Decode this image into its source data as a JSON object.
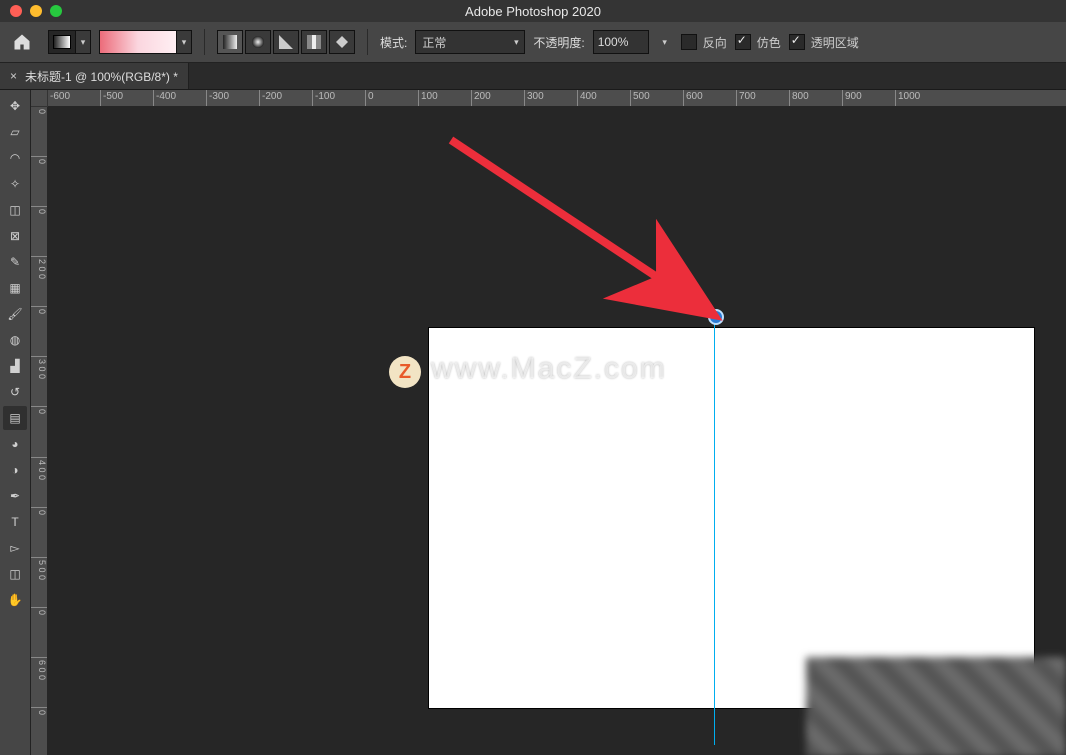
{
  "app": {
    "title": "Adobe Photoshop 2020"
  },
  "options": {
    "mode_label": "模式:",
    "mode_value": "正常",
    "opacity_label": "不透明度:",
    "opacity_value": "100%",
    "reverse_label": "反向",
    "dither_label": "仿色",
    "transparency_label": "透明区域",
    "reverse_checked": false,
    "dither_checked": true,
    "transparency_checked": true
  },
  "tab": {
    "label": "未标题-1 @ 100%(RGB/8*) *",
    "close": "×"
  },
  "ruler_h": [
    "-600",
    "-500",
    "-400",
    "-300",
    "-200",
    "-100",
    "0",
    "100",
    "200",
    "300",
    "400",
    "500",
    "600",
    "700",
    "800",
    "900",
    "1000"
  ],
  "ruler_v": [
    "0",
    "0",
    "0",
    "2 0 0",
    "0",
    "3 0 0",
    "0",
    "4 0 0",
    "0",
    "5 0 0",
    "0",
    "6 0 0",
    "0"
  ],
  "tools": [
    {
      "name": "move-tool",
      "glyph": "✥"
    },
    {
      "name": "frame-tool",
      "glyph": "▱"
    },
    {
      "name": "lasso-tool",
      "glyph": "◠"
    },
    {
      "name": "wand-tool",
      "glyph": "✧"
    },
    {
      "name": "crop-tool",
      "glyph": "◫"
    },
    {
      "name": "slice-tool",
      "glyph": "⊠"
    },
    {
      "name": "eyedropper-tool",
      "glyph": "✎"
    },
    {
      "name": "marquee-tool",
      "glyph": "▦"
    },
    {
      "name": "brush-tool",
      "glyph": "🖌"
    },
    {
      "name": "healing-tool",
      "glyph": "◍"
    },
    {
      "name": "stamp-tool",
      "glyph": "▟"
    },
    {
      "name": "history-brush-tool",
      "glyph": "↺"
    },
    {
      "name": "gradient-tool",
      "glyph": "▤"
    },
    {
      "name": "blur-tool",
      "glyph": "◕"
    },
    {
      "name": "dodge-tool",
      "glyph": "◑"
    },
    {
      "name": "pen-tool",
      "glyph": "✒"
    },
    {
      "name": "type-tool",
      "glyph": "T"
    },
    {
      "name": "path-select-tool",
      "glyph": "▻"
    },
    {
      "name": "shape-tool",
      "glyph": "◫"
    },
    {
      "name": "hand-tool",
      "glyph": "✋"
    }
  ],
  "watermark": {
    "badge": "Z",
    "text": "www.MacZ.com"
  }
}
